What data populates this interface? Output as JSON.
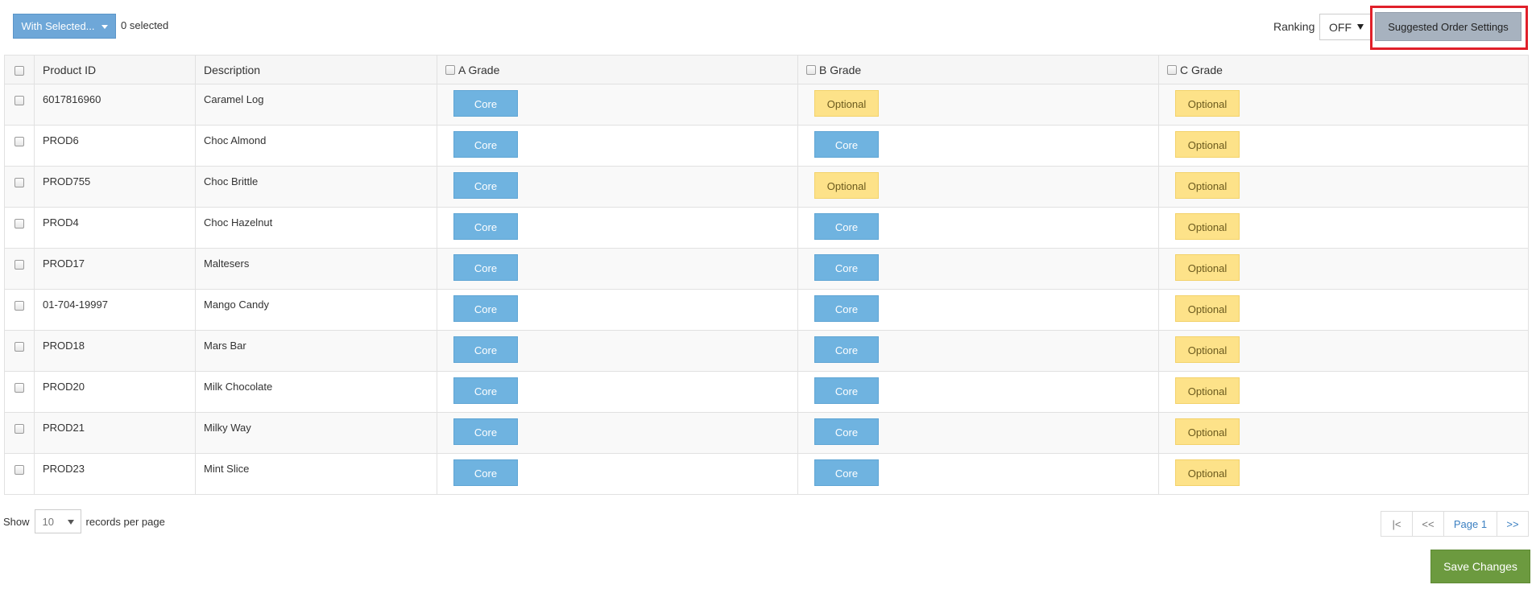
{
  "toolbar": {
    "with_selected_label": "With Selected...",
    "selected_count": "0 selected",
    "ranking_label": "Ranking",
    "ranking_value": "OFF",
    "suggested_order_label": "Suggested Order Settings"
  },
  "table": {
    "headers": {
      "product_id": "Product ID",
      "description": "Description",
      "a_grade": "A Grade",
      "b_grade": "B Grade",
      "c_grade": "C Grade"
    },
    "rows": [
      {
        "product_id": "6017816960",
        "description": "Caramel Log",
        "a": "Core",
        "b": "Optional",
        "c": "Optional"
      },
      {
        "product_id": "PROD6",
        "description": "Choc Almond",
        "a": "Core",
        "b": "Core",
        "c": "Optional"
      },
      {
        "product_id": "PROD755",
        "description": "Choc Brittle",
        "a": "Core",
        "b": "Optional",
        "c": "Optional"
      },
      {
        "product_id": "PROD4",
        "description": "Choc Hazelnut",
        "a": "Core",
        "b": "Core",
        "c": "Optional"
      },
      {
        "product_id": "PROD17",
        "description": "Maltesers",
        "a": "Core",
        "b": "Core",
        "c": "Optional"
      },
      {
        "product_id": "01-704-19997",
        "description": "Mango Candy",
        "a": "Core",
        "b": "Core",
        "c": "Optional"
      },
      {
        "product_id": "PROD18",
        "description": "Mars Bar",
        "a": "Core",
        "b": "Core",
        "c": "Optional"
      },
      {
        "product_id": "PROD20",
        "description": "Milk Chocolate",
        "a": "Core",
        "b": "Core",
        "c": "Optional"
      },
      {
        "product_id": "PROD21",
        "description": "Milky Way",
        "a": "Core",
        "b": "Core",
        "c": "Optional"
      },
      {
        "product_id": "PROD23",
        "description": "Mint Slice",
        "a": "Core",
        "b": "Core",
        "c": "Optional"
      }
    ]
  },
  "footer": {
    "show_label": "Show",
    "per_page_value": "10",
    "records_label": "records per page",
    "pager_first": "|<",
    "pager_prev": "<<",
    "pager_current": "Page 1",
    "pager_next": ">>",
    "save_label": "Save Changes"
  },
  "colors": {
    "core": "#6fb3e0",
    "optional": "#fde289",
    "save": "#6c9a3f",
    "with_selected": "#6ea7d8",
    "highlight": "#e0202a"
  }
}
